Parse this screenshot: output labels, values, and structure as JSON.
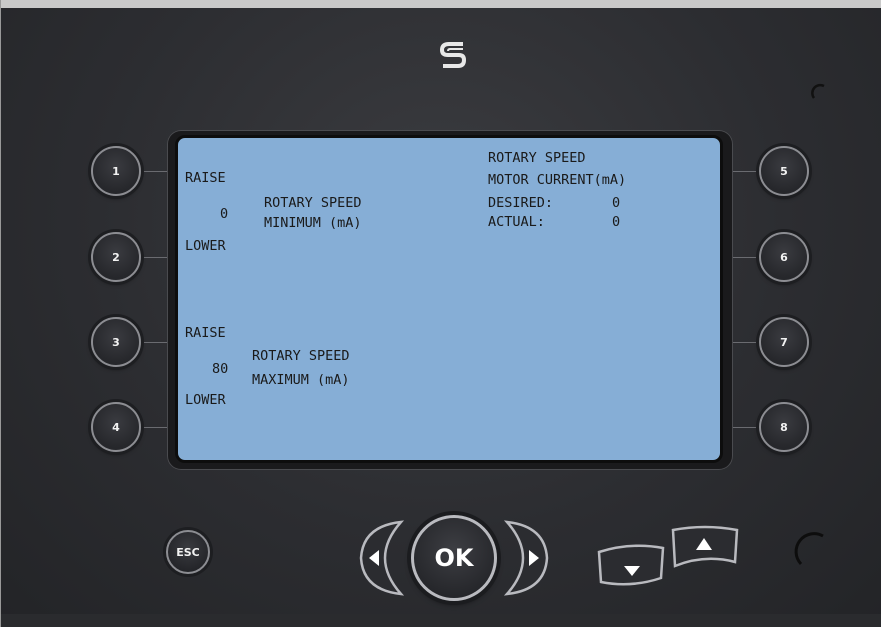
{
  "device": {
    "logo_icon": "s-logo-icon",
    "accent_color": "#86aed6"
  },
  "screen": {
    "group1": {
      "raise_label": "RAISE",
      "value": "0",
      "lower_label": "LOWER",
      "title_line1": "ROTARY SPEED",
      "title_line2": "MINIMUM (mA)"
    },
    "group2": {
      "raise_label": "RAISE",
      "value": "80",
      "lower_label": "LOWER",
      "title_line1": "ROTARY SPEED",
      "title_line2": "MAXIMUM (mA)"
    },
    "status": {
      "title_line1": "ROTARY SPEED",
      "title_line2": "MOTOR CURRENT(mA)",
      "desired_label": "DESIRED:",
      "desired_value": "0",
      "actual_label": "ACTUAL:",
      "actual_value": "0"
    }
  },
  "buttons": {
    "left": [
      "1",
      "2",
      "3",
      "4"
    ],
    "right": [
      "5",
      "6",
      "7",
      "8"
    ],
    "esc": "ESC",
    "ok": "OK",
    "left_arrow_icon": "triangle-left-icon",
    "right_arrow_icon": "triangle-right-icon",
    "down_icon": "triangle-down-icon",
    "up_icon": "triangle-up-icon"
  }
}
